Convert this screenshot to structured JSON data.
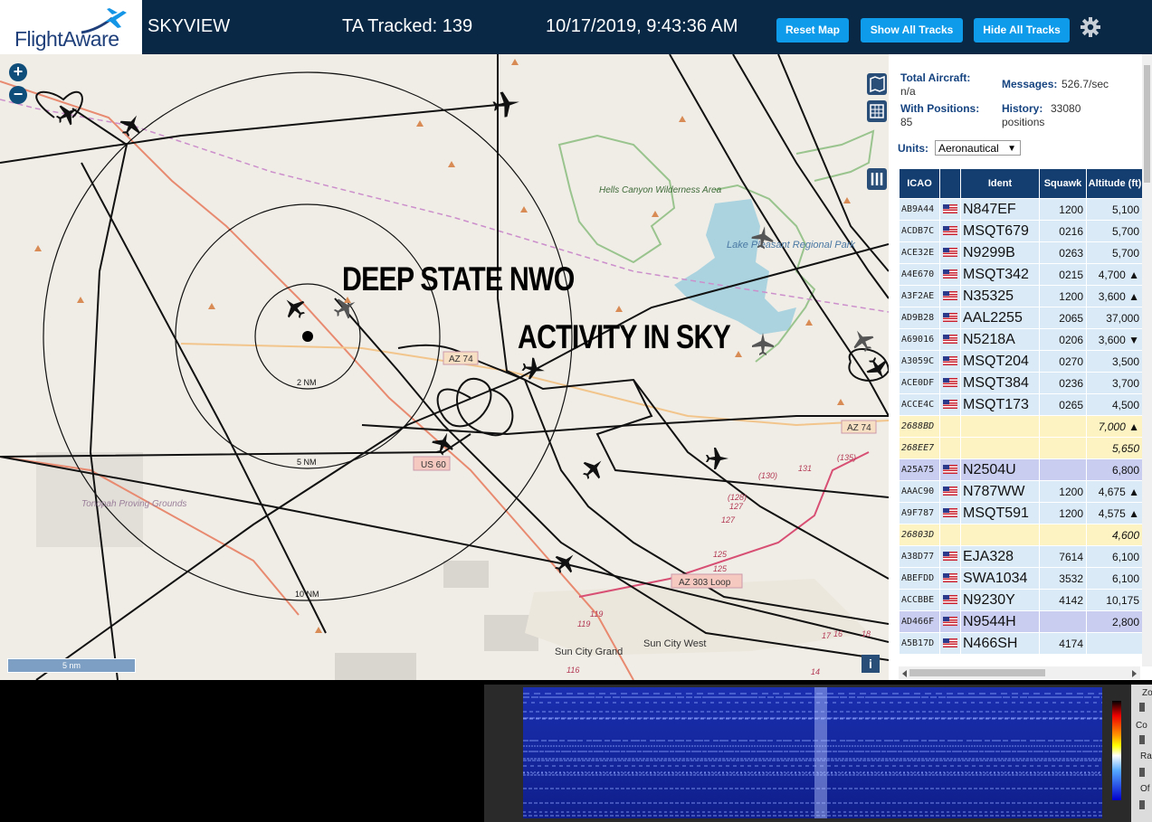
{
  "header": {
    "logo_text": "FlightAware",
    "app_title": "SKYVIEW",
    "tracked": "TA Tracked: 139",
    "datetime": "10/17/2019, 9:43:36 AM",
    "reset_map": "Reset Map",
    "show_all": "Show All Tracks",
    "hide_all": "Hide All Tracks"
  },
  "map": {
    "zoom_in": "+",
    "zoom_out": "−",
    "scale": "5 nm",
    "ring_labels": [
      "2 NM",
      "5 NM",
      "10 NM"
    ],
    "places": [
      "Hells Canyon Wilderness Area",
      "Lake Pleasant Regional Park",
      "Tonopah Proving Grounds",
      "Sun City Grand",
      "Sun City West"
    ],
    "roads": [
      "AZ 74",
      "AZ 74",
      "US 60",
      "AZ 303 Loop"
    ],
    "route_numbers": [
      "(130)",
      "(135)",
      "131",
      "(128)",
      "127",
      "127",
      "125",
      "125",
      "119",
      "119",
      "116",
      "17",
      "16",
      "18",
      "14"
    ],
    "banner_line1": "DEEP STATE NWO",
    "banner_line2": "ACTIVITY IN SKY",
    "info": "i"
  },
  "panel": {
    "total_label": "Total Aircraft:",
    "total_value": "n/a",
    "with_pos_label": "With Positions:",
    "with_pos_value": "85",
    "messages_label": "Messages:",
    "messages_value": "526.7/sec",
    "history_label": "History:",
    "history_value": "33080 positions",
    "units_label": "Units:",
    "units_value": "Aeronautical",
    "columns": [
      "ICAO",
      "",
      "Ident",
      "Squawk",
      "Altitude (ft)"
    ],
    "rows": [
      {
        "icao": "AB9A44",
        "flag": true,
        "ident": "N847EF",
        "squawk": "1200",
        "alt": "5,100",
        "style": "blue"
      },
      {
        "icao": "ACDB7C",
        "flag": true,
        "ident": "MSQT679",
        "squawk": "0216",
        "alt": "5,700",
        "style": "blue"
      },
      {
        "icao": "ACE32E",
        "flag": true,
        "ident": "N9299B",
        "squawk": "0263",
        "alt": "5,700",
        "style": "blue"
      },
      {
        "icao": "A4E670",
        "flag": true,
        "ident": "MSQT342",
        "squawk": "0215",
        "alt": "4,700 ▲",
        "style": "blue"
      },
      {
        "icao": "A3F2AE",
        "flag": true,
        "ident": "N35325",
        "squawk": "1200",
        "alt": "3,600 ▲",
        "style": "blue"
      },
      {
        "icao": "AD9B28",
        "flag": true,
        "ident": "AAL2255",
        "squawk": "2065",
        "alt": "37,000",
        "style": "blue"
      },
      {
        "icao": "A69016",
        "flag": true,
        "ident": "N5218A",
        "squawk": "0206",
        "alt": "3,600 ▼",
        "style": "blue"
      },
      {
        "icao": "A3059C",
        "flag": true,
        "ident": "MSQT204",
        "squawk": "0270",
        "alt": "3,500",
        "style": "blue"
      },
      {
        "icao": "ACE0DF",
        "flag": true,
        "ident": "MSQT384",
        "squawk": "0236",
        "alt": "3,700",
        "style": "blue"
      },
      {
        "icao": "ACCE4C",
        "flag": true,
        "ident": "MSQT173",
        "squawk": "0265",
        "alt": "4,500",
        "style": "blue"
      },
      {
        "icao": "2688BD",
        "flag": false,
        "ident": "",
        "squawk": "",
        "alt": "7,000 ▲",
        "style": "yellow"
      },
      {
        "icao": "268EE7",
        "flag": false,
        "ident": "",
        "squawk": "",
        "alt": "5,650",
        "style": "yellow"
      },
      {
        "icao": "A25A75",
        "flag": true,
        "ident": "N2504U",
        "squawk": "",
        "alt": "6,800",
        "style": "lav"
      },
      {
        "icao": "AAAC90",
        "flag": true,
        "ident": "N787WW",
        "squawk": "1200",
        "alt": "4,675 ▲",
        "style": "blue"
      },
      {
        "icao": "A9F787",
        "flag": true,
        "ident": "MSQT591",
        "squawk": "1200",
        "alt": "4,575 ▲",
        "style": "blue"
      },
      {
        "icao": "26803D",
        "flag": false,
        "ident": "",
        "squawk": "",
        "alt": "4,600",
        "style": "yellow"
      },
      {
        "icao": "A38D77",
        "flag": true,
        "ident": "EJA328",
        "squawk": "7614",
        "alt": "6,100",
        "style": "blue"
      },
      {
        "icao": "ABEFDD",
        "flag": true,
        "ident": "SWA1034",
        "squawk": "3532",
        "alt": "6,100",
        "style": "blue"
      },
      {
        "icao": "ACCBBE",
        "flag": true,
        "ident": "N9230Y",
        "squawk": "4142",
        "alt": "10,175",
        "style": "blue"
      },
      {
        "icao": "AD466F",
        "flag": true,
        "ident": "N9544H",
        "squawk": "",
        "alt": "2,800",
        "style": "lav"
      },
      {
        "icao": "A5B17D",
        "flag": true,
        "ident": "N466SH",
        "squawk": "4174",
        "alt": "",
        "style": "blue"
      }
    ]
  },
  "spectrum": {
    "labels": [
      "Zo",
      "Co",
      "Ra",
      "Of"
    ]
  },
  "colors": {
    "header_bg": "#082845",
    "button_bg": "#0d9bea",
    "table_header": "#133e6f"
  }
}
